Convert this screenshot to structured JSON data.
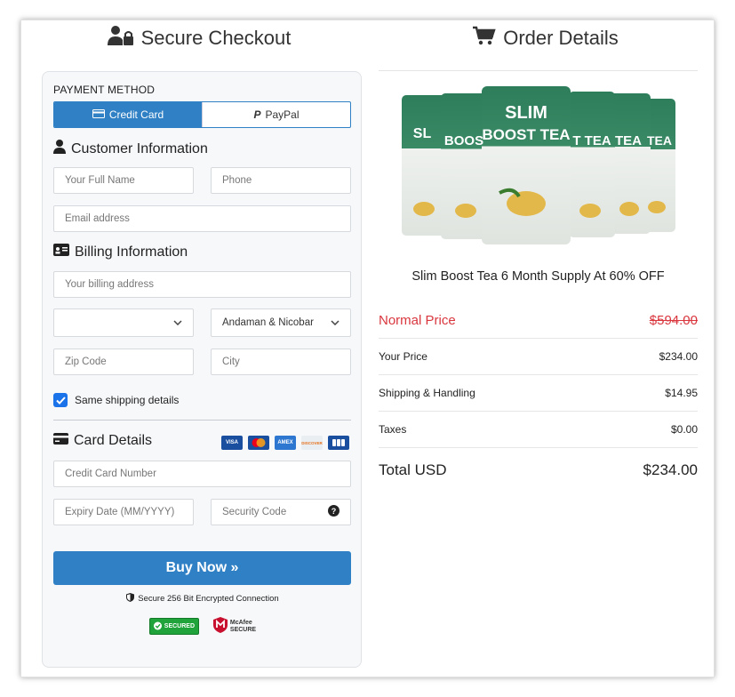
{
  "checkout": {
    "title": "Secure Checkout",
    "payment_method_label": "PAYMENT METHOD",
    "tabs": [
      {
        "label": "Credit Card",
        "active": true
      },
      {
        "label": "PayPal",
        "active": false
      }
    ],
    "customer_info": {
      "title": "Customer Information",
      "full_name_placeholder": "Your Full Name",
      "phone_placeholder": "Phone",
      "email_placeholder": "Email address"
    },
    "billing_info": {
      "title": "Billing Information",
      "address_placeholder": "Your billing address",
      "country_value": "",
      "state_value": "Andaman & Nicobar",
      "zip_placeholder": "Zip Code",
      "city_placeholder": "City"
    },
    "same_shipping_label": "Same shipping details",
    "same_shipping_checked": true,
    "card_details": {
      "title": "Card Details",
      "brands": [
        "VISA",
        "mastercard",
        "AMEX",
        "DISCOVER",
        "JCB"
      ],
      "card_number_placeholder": "Credit Card Number",
      "expiry_placeholder": "Expiry Date (MM/YYYY)",
      "security_code_placeholder": "Security Code"
    },
    "buy_button": "Buy Now »",
    "secure_note": "Secure 256 Bit Encrypted Connection",
    "badges": {
      "secured": "SECURED",
      "mcafee_line1": "McAfee",
      "mcafee_line2": "SECURE"
    }
  },
  "order": {
    "title": "Order Details",
    "product_name": "Slim Boost Tea 6 Month Supply At 60% OFF",
    "pouch_text": {
      "line1": "SLIM",
      "line2": "BOOST TEA"
    },
    "rows": [
      {
        "label": "Normal Price",
        "amount": "$594.00",
        "style": "normal"
      },
      {
        "label": "Your Price",
        "amount": "$234.00",
        "style": "regular"
      },
      {
        "label": "Shipping & Handling",
        "amount": "$14.95",
        "style": "regular"
      },
      {
        "label": "Taxes",
        "amount": "$0.00",
        "style": "regular"
      },
      {
        "label": "Total USD",
        "amount": "$234.00",
        "style": "total"
      }
    ]
  },
  "colors": {
    "accent": "#2f80c4",
    "strike_red": "#d9363e",
    "tea_green": "#2e7d5b"
  }
}
